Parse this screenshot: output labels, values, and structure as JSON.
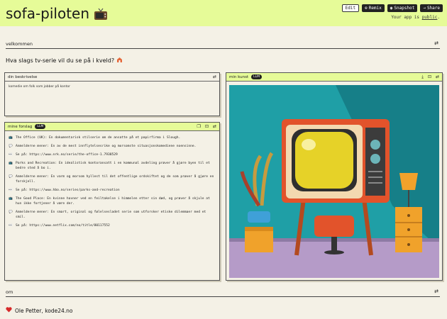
{
  "header": {
    "app_title": "sofa-piloten",
    "buttons": {
      "edit": "Edit",
      "remix": "Remix",
      "snapshot": "Snapshot",
      "share": "Share"
    },
    "public_prefix": "Your app is",
    "public_link": "public",
    "public_suffix": "."
  },
  "welcome": {
    "section_label": "velkommen",
    "question": "Hva slags tv-serie vil du se på i kveld?"
  },
  "description": {
    "label": "din beskrivelse",
    "value": "komedie om folk som jobber på kontor"
  },
  "art": {
    "label": "min kunst",
    "badge": "LLM"
  },
  "suggestions": {
    "label": "mine forslag",
    "badge": "LLM",
    "lines": [
      {
        "icon": "tv",
        "text": "The Office (UK): En dokumentarisk stilserie om de ansatte på et papirfirma i Slough."
      },
      {
        "icon": "speech",
        "text": "Anmeldernе mener: En av de mest innflytelsesrike og morsomste situasjonskomediene noensinne."
      },
      {
        "icon": "eyes",
        "text": "Se på: https://www.nrk.no/serie/the-office-1.7938529"
      },
      {
        "icon": "tv",
        "text": "Parks and Recreation: En idealistisk kontoransatt i en kommunal avdeling prøver å gjøre byen til et bedre sted å bo i."
      },
      {
        "icon": "speech",
        "text": "Anmeldernе mener: En varm og morsom hyllest til det offentlige ordskiftet og de som prøver å gjøre en forskjell."
      },
      {
        "icon": "eyes",
        "text": "Se på: https://www.hbo.no/series/parks-and-recreation"
      },
      {
        "icon": "tv",
        "text": "The Good Place: En kvinne havner ved en feiltakelse i himmelen etter sin død, og prøver å skjule at hun ikke fortjener å være der."
      },
      {
        "icon": "speech",
        "text": "Anmeldernе mener: En smart, original og følelsesladet serie som utforsker etiske dilemmaer med et smil."
      },
      {
        "icon": "eyes",
        "text": "Se på: https://www.netflix.com/no/title/80117552"
      }
    ]
  },
  "about": {
    "section_label": "om",
    "credit": "Ole Petter, kode24.no"
  }
}
